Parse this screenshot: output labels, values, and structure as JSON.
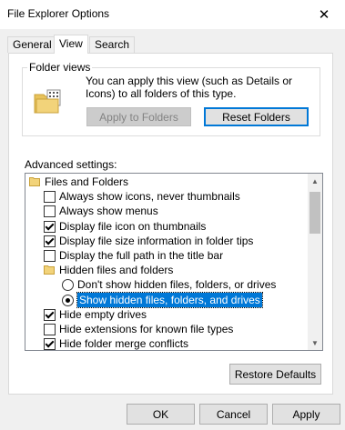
{
  "window": {
    "title": "File Explorer Options",
    "close_glyph": "✕"
  },
  "tabs": [
    {
      "label": "General",
      "active": false
    },
    {
      "label": "View",
      "active": true
    },
    {
      "label": "Search",
      "active": false
    }
  ],
  "folder_views": {
    "label": "Folder views",
    "description": "You can apply this view (such as Details or Icons) to all folders of this type.",
    "apply_button": "Apply to Folders",
    "reset_button": "Reset Folders",
    "icon": "folder-icon"
  },
  "advanced": {
    "label": "Advanced settings:",
    "items": [
      {
        "type": "folder",
        "label": "Files and Folders"
      },
      {
        "type": "checkbox",
        "label": "Always show icons, never thumbnails",
        "checked": false
      },
      {
        "type": "checkbox",
        "label": "Always show menus",
        "checked": false
      },
      {
        "type": "checkbox",
        "label": "Display file icon on thumbnails",
        "checked": true
      },
      {
        "type": "checkbox",
        "label": "Display file size information in folder tips",
        "checked": true
      },
      {
        "type": "checkbox",
        "label": "Display the full path in the title bar",
        "checked": false
      },
      {
        "type": "folder",
        "label": "Hidden files and folders"
      },
      {
        "type": "radio",
        "label": "Don't show hidden files, folders, or drives",
        "checked": false
      },
      {
        "type": "radio",
        "label": "Show hidden files, folders, and drives",
        "checked": true,
        "selected": true
      },
      {
        "type": "checkbox",
        "label": "Hide empty drives",
        "checked": true
      },
      {
        "type": "checkbox",
        "label": "Hide extensions for known file types",
        "checked": false
      },
      {
        "type": "checkbox",
        "label": "Hide folder merge conflicts",
        "checked": true
      }
    ]
  },
  "restore_button": "Restore Defaults",
  "footer": {
    "ok": "OK",
    "cancel": "Cancel",
    "apply": "Apply"
  }
}
